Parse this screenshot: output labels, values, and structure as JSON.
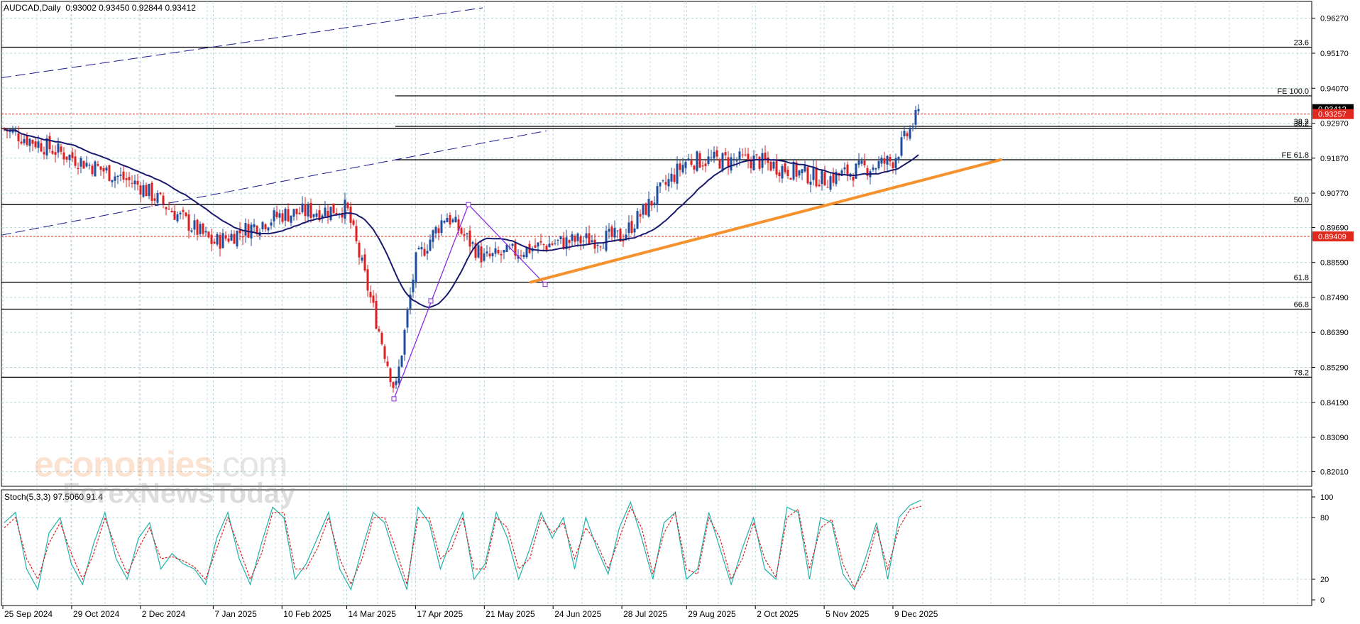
{
  "header": {
    "symbol": "AUDCAD,Daily",
    "ohlc": "0.93002 0.93450 0.92844 0.93412"
  },
  "watermark": {
    "brand": "economies",
    "brand_suffix": ".com",
    "tagline": "ForexNewsToday"
  },
  "stoch": {
    "label": "Stoch(5,3,3) 97.5060 91.4",
    "levels": [
      "100",
      "80",
      "20",
      "0"
    ]
  },
  "chart_data": [
    {
      "type": "candlestick",
      "title": "AUDCAD,Daily",
      "ylim": [
        0.8155,
        0.968
      ],
      "price_ticks": [
        "0.96270",
        "0.95170",
        "0.94070",
        "0.92970",
        "0.91870",
        "0.90770",
        "0.89690",
        "0.88590",
        "0.87490",
        "0.86390",
        "0.85290",
        "0.84190",
        "0.83090",
        "0.82010"
      ],
      "date_labels": [
        "25 Sep 2024",
        "29 Oct 2024",
        "2 Dec 2024",
        "7 Jan 2025",
        "10 Feb 2025",
        "14 Mar 2025",
        "17 Apr 2025",
        "21 May 2025",
        "24 Jun 2025",
        "28 Jul 2025",
        "29 Aug 2025",
        "2 Oct 2025",
        "5 Nov 2025",
        "9 Dec 2025"
      ],
      "price_tags": [
        {
          "label": "0.93412",
          "value": 0.93412,
          "color": "#000000"
        },
        {
          "label": "0.93257",
          "value": 0.93257,
          "color": "#e0281e"
        },
        {
          "label": "0.89409",
          "value": 0.89409,
          "color": "#e0281e"
        }
      ],
      "fibo_levels": [
        {
          "label": "23.6",
          "value": 0.9536
        },
        {
          "label": "FE 100.0",
          "value": 0.9383
        },
        {
          "label": "38.2",
          "value": 0.9287
        },
        {
          "label": "38.2",
          "value": 0.9281
        },
        {
          "label": "FE 61.8",
          "value": 0.9182
        },
        {
          "label": "50.0",
          "value": 0.9041
        },
        {
          "label": "61.8",
          "value": 0.8797
        },
        {
          "label": "66.8",
          "value": 0.8712
        },
        {
          "label": "78.2",
          "value": 0.8498
        }
      ],
      "closes_anchor": [
        {
          "date": "25 Sep 2024",
          "close": 0.928
        },
        {
          "date": "29 Oct 2024",
          "close": 0.919
        },
        {
          "date": "2 Dec 2024",
          "close": 0.91
        },
        {
          "date": "7 Jan 2025",
          "close": 0.892
        },
        {
          "date": "10 Feb 2025",
          "close": 0.901
        },
        {
          "date": "14 Mar 2025",
          "close": 0.903
        },
        {
          "date": "7 Apr 2025",
          "close": 0.845
        },
        {
          "date": "17 Apr 2025",
          "close": 0.886
        },
        {
          "date": "2 May 2025",
          "close": 0.901
        },
        {
          "date": "21 May 2025",
          "close": 0.887
        },
        {
          "date": "24 Jun 2025",
          "close": 0.892
        },
        {
          "date": "28 Jul 2025",
          "close": 0.894
        },
        {
          "date": "29 Aug 2025",
          "close": 0.918
        },
        {
          "date": "2 Oct 2025",
          "close": 0.918
        },
        {
          "date": "5 Nov 2025",
          "close": 0.912
        },
        {
          "date": "9 Dec 2025",
          "close": 0.918
        },
        {
          "date": "23 Dec 2025",
          "close": 0.9341
        }
      ],
      "colors": {
        "up": "#1f4e9c",
        "down": "#e02020",
        "ma": "#1a1a6e",
        "trendline": "#f5922e",
        "zigzag": "#8a2be2",
        "grid": "#b8d4d8"
      }
    },
    {
      "type": "line",
      "title": "Stoch(5,3,3)",
      "ylim": [
        0,
        100
      ],
      "series": [
        {
          "values": [
            75,
            85,
            30,
            10,
            65,
            80,
            35,
            15,
            55,
            85,
            40,
            20,
            60,
            75,
            30,
            45,
            35,
            30,
            15,
            60,
            85,
            40,
            15,
            55,
            90,
            80,
            20,
            35,
            60,
            85,
            30,
            10,
            50,
            85,
            75,
            40,
            10,
            90,
            75,
            30,
            60,
            85,
            20,
            35,
            85,
            60,
            20,
            50,
            85,
            60,
            80,
            30,
            80,
            50,
            25,
            70,
            95,
            60,
            20,
            75,
            85,
            20,
            30,
            85,
            50,
            15,
            50,
            80,
            30,
            20,
            90,
            85,
            20,
            80,
            75,
            25,
            10,
            40,
            75,
            20,
            80,
            92,
            97
          ]
        },
        {
          "values": [
            70,
            80,
            40,
            20,
            55,
            75,
            45,
            20,
            45,
            80,
            50,
            25,
            50,
            70,
            40,
            42,
            38,
            32,
            20,
            50,
            80,
            50,
            20,
            45,
            85,
            85,
            30,
            30,
            50,
            80,
            40,
            15,
            40,
            80,
            80,
            50,
            15,
            80,
            80,
            40,
            50,
            80,
            30,
            30,
            80,
            70,
            30,
            40,
            80,
            65,
            75,
            40,
            70,
            55,
            30,
            60,
            90,
            70,
            25,
            65,
            85,
            30,
            25,
            80,
            60,
            20,
            40,
            75,
            40,
            22,
            80,
            88,
            30,
            70,
            78,
            35,
            12,
            30,
            70,
            30,
            70,
            88,
            91
          ]
        }
      ]
    }
  ]
}
